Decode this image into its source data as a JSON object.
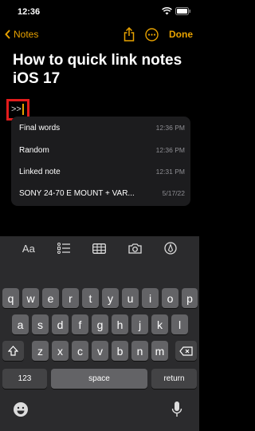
{
  "status_bar": {
    "time": "12:36"
  },
  "nav": {
    "back_label": "Notes",
    "done_label": "Done"
  },
  "note": {
    "title": "How to quick link notes iOS 17",
    "typed_text": ">>"
  },
  "link_suggestions": [
    {
      "name": "Final words",
      "time": "12:36 PM"
    },
    {
      "name": "Random",
      "time": "12:36 PM"
    },
    {
      "name": "Linked note",
      "time": "12:31 PM"
    },
    {
      "name": "SONY 24-70 E MOUNT + VAR...",
      "time": "5/17/22"
    }
  ],
  "toolbar": {
    "format_label": "Aa",
    "icons": [
      "list-icon",
      "table-icon",
      "camera-icon",
      "markup-icon"
    ]
  },
  "keyboard": {
    "row1": [
      "q",
      "w",
      "e",
      "r",
      "t",
      "y",
      "u",
      "i",
      "o",
      "p"
    ],
    "row2": [
      "a",
      "s",
      "d",
      "f",
      "g",
      "h",
      "j",
      "k",
      "l"
    ],
    "row3": [
      "z",
      "x",
      "c",
      "v",
      "b",
      "n",
      "m"
    ],
    "numbers_label": "123",
    "space_label": "space",
    "return_label": "return"
  },
  "colors": {
    "accent": "#e8a200",
    "highlight": "#e21c1c",
    "keyboard_bg": "#2b2b2d",
    "key_bg": "#636366"
  }
}
